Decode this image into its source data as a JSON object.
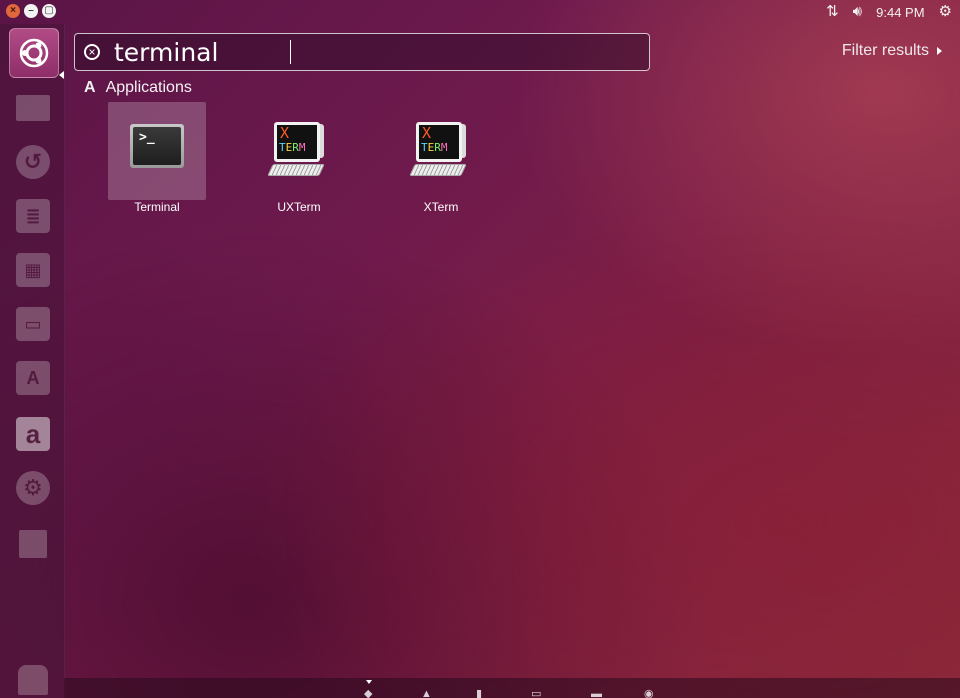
{
  "topbar": {
    "clock": "9:44 PM",
    "icons": [
      "network-icon",
      "volume-icon",
      "session-gear-icon"
    ],
    "window_controls": {
      "close": "×",
      "minimize": "–",
      "maximize": "▢"
    }
  },
  "launcher": {
    "items": [
      "dash-home-icon",
      "files-icon",
      "backups-icon",
      "writer-icon",
      "calc-icon",
      "impress-icon",
      "software-center-icon",
      "amazon-icon",
      "system-settings-icon",
      "workspace-switcher-icon",
      "trash-icon"
    ],
    "amazon_letter": "a"
  },
  "search": {
    "query": "terminal",
    "clear_glyph": "×"
  },
  "filter": {
    "label": "Filter results"
  },
  "results": {
    "category": "Applications",
    "category_icon": "A",
    "items": [
      {
        "label": "Terminal",
        "icon": "terminal-icon",
        "prompt": ">_"
      },
      {
        "label": "UXTerm",
        "icon": "uxterm-icon",
        "x_glyph": "X",
        "term_glyphs": [
          "T",
          "E",
          "R",
          "M"
        ]
      },
      {
        "label": "XTerm",
        "icon": "xterm-icon",
        "x_glyph": "X",
        "term_glyphs": [
          "T",
          "E",
          "R",
          "M"
        ]
      }
    ]
  },
  "lenses": [
    "home-lens-icon",
    "applications-lens-icon",
    "files-lens-icon",
    "video-lens-icon",
    "music-lens-icon",
    "photos-lens-icon"
  ]
}
